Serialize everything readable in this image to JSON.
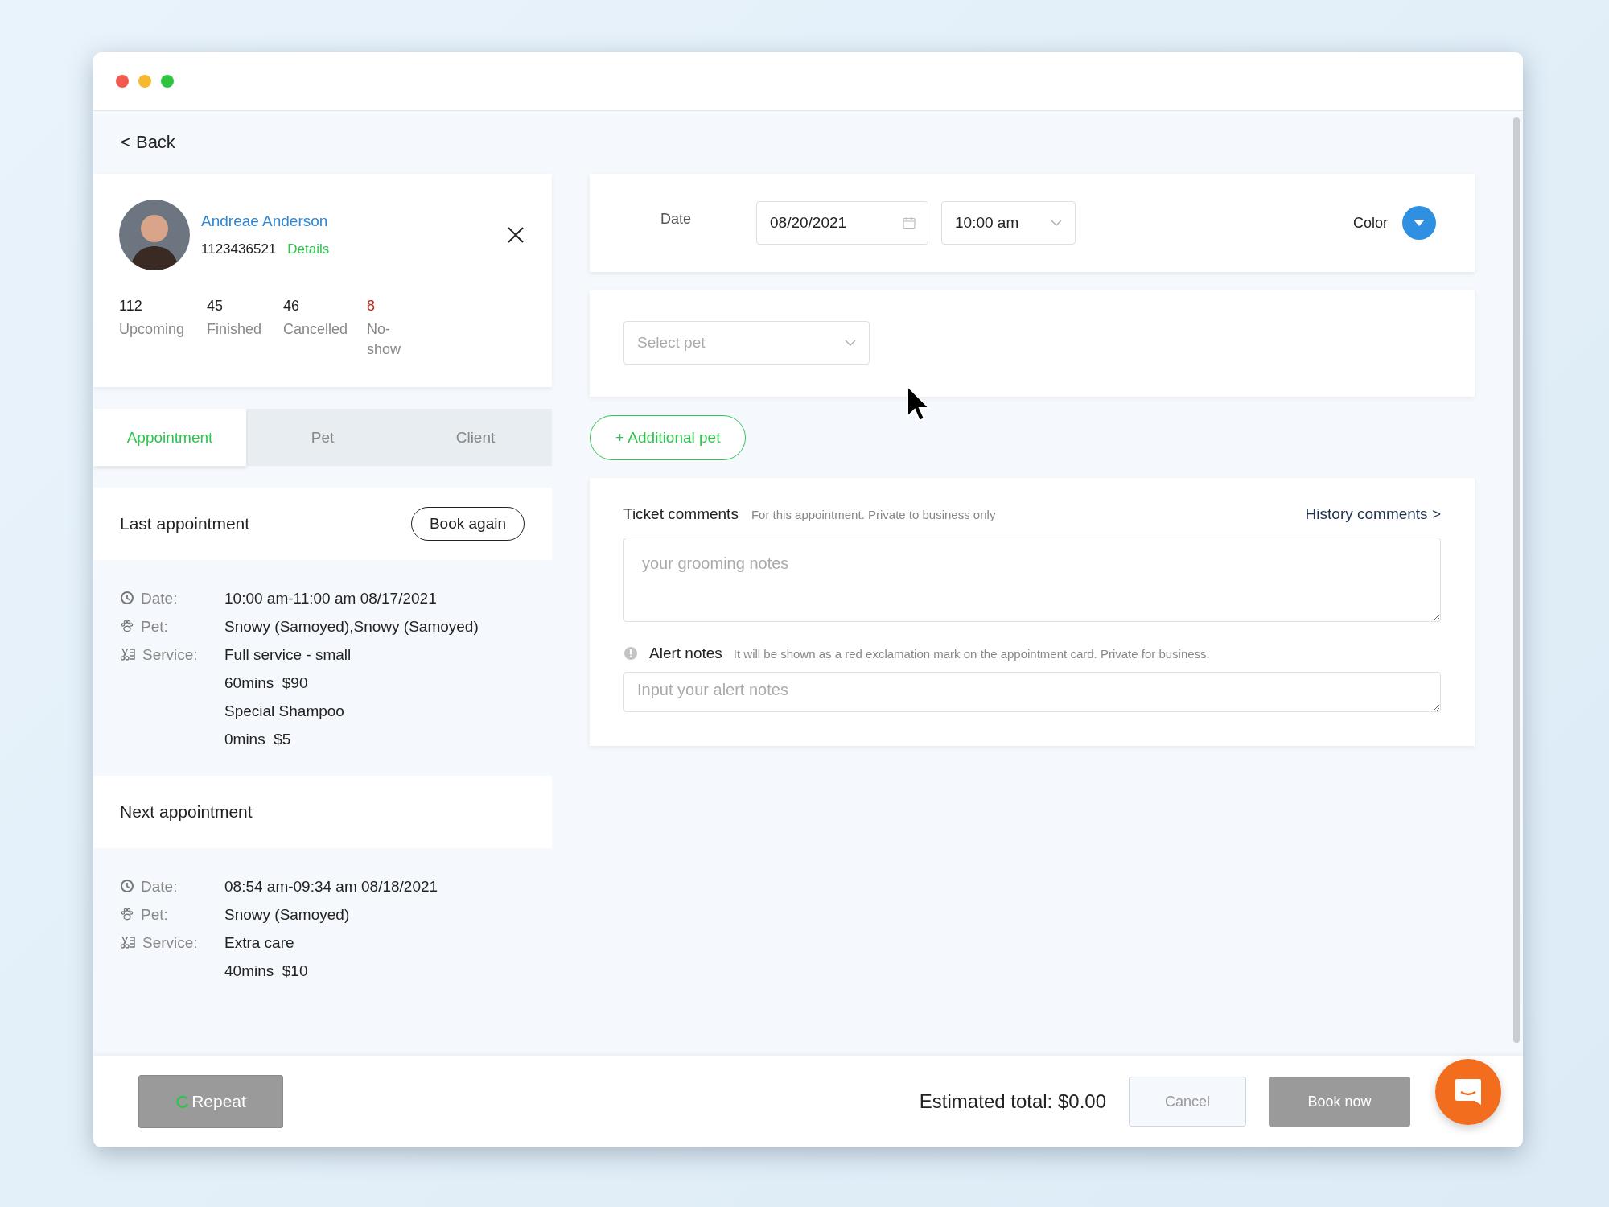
{
  "back_link": "< Back",
  "client": {
    "name": "Andreae Anderson",
    "phone": "1123436521",
    "details_link": "Details",
    "stats": [
      {
        "value": "112",
        "label": "Upcoming",
        "color": "#222222"
      },
      {
        "value": "45",
        "label": "Finished",
        "color": "#222222"
      },
      {
        "value": "46",
        "label": "Cancelled",
        "color": "#222222"
      },
      {
        "value": "8",
        "label": "No-show",
        "color": "#c0281c"
      }
    ]
  },
  "tabs": [
    {
      "label": "Appointment",
      "selected": true
    },
    {
      "label": "Pet",
      "selected": false
    },
    {
      "label": "Client",
      "selected": false
    }
  ],
  "last_appointment": {
    "title": "Last appointment",
    "button": "Book again",
    "rows": [
      {
        "kind": "date",
        "label": "Date:",
        "values": [
          "10:00 am-11:00 am 08/17/2021"
        ]
      },
      {
        "kind": "pet",
        "label": "Pet:",
        "values": [
          "Snowy (Samoyed),Snowy (Samoyed)"
        ]
      },
      {
        "kind": "service",
        "label": "Service:",
        "values": [
          "Full service - small",
          "60mins  $90",
          "Special Shampoo",
          "0mins  $5"
        ]
      }
    ]
  },
  "next_appointment": {
    "title": "Next appointment",
    "rows": [
      {
        "kind": "date",
        "label": "Date:",
        "values": [
          "08:54 am-09:34 am 08/18/2021"
        ]
      },
      {
        "kind": "pet",
        "label": "Pet:",
        "values": [
          "Snowy (Samoyed)"
        ]
      },
      {
        "kind": "service",
        "label": "Service:",
        "values": [
          "Extra care",
          "40mins  $10"
        ]
      }
    ]
  },
  "schedule": {
    "date_label": "Date",
    "date": "08/20/2021",
    "time": "10:00 am",
    "color_label": "Color",
    "color": "#2f8fe0"
  },
  "pet_select": {
    "placeholder": "Select pet"
  },
  "additional_pet_button": "+ Additional pet",
  "ticket_comments": {
    "title": "Ticket comments",
    "hint": "For this appointment. Private to business only",
    "history_link": "History comments >",
    "placeholder": "your grooming notes"
  },
  "alert_notes": {
    "title": "Alert notes",
    "hint": "It will be shown as a red exclamation mark on the appointment card. Private for business.",
    "placeholder": "Input your alert notes"
  },
  "footer": {
    "repeat_button": "Repeat",
    "estimated_total": "Estimated total: $0.00",
    "cancel_button": "Cancel",
    "book_button": "Book now"
  }
}
